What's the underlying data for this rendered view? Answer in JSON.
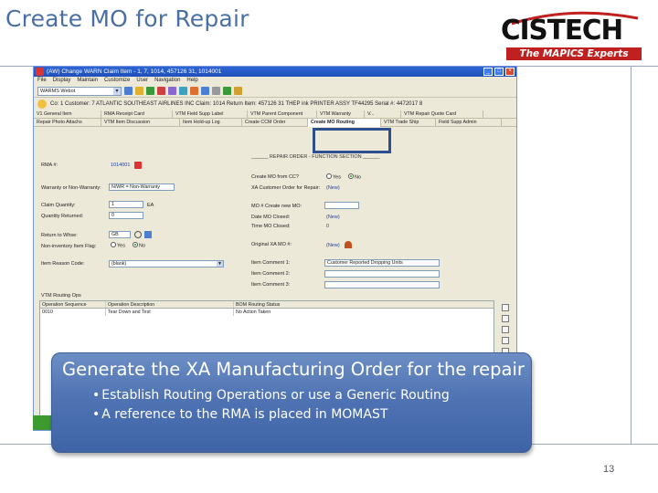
{
  "slide": {
    "title": "Create MO for Repair",
    "page_number": "13"
  },
  "logo": {
    "brand": "CISTECH",
    "tagline": "The MAPICS Experts",
    "color": "#c0201f"
  },
  "window": {
    "title": "(AW) Change WARN Claim Item - 1, 7, 1014, 457126 31, 1014001",
    "menu": [
      "File",
      "Display",
      "Maintain",
      "Customize",
      "User",
      "Navigation",
      "Help"
    ],
    "view_select": "WARMS Webot",
    "header_line": "Co: 1  Customer: 7 ATLANTIC SOUTHEAST AIRLINES INC  Claim: 1014  Return Item: 457126 31 THEP ink  PRINTER ASSY TF44295 Serial #: 4472017 8",
    "tabs_row1": [
      "V1 General Item",
      "RMA Receipt Card",
      "VTM Field Supp Label",
      "VTM Parent Component",
      "VTM Warranty",
      "V...",
      "VTM Repair Quote Card"
    ],
    "tabs_row2": [
      "Repair Photo Attachs",
      "VTM Item Discussion",
      "Item Hold-up Log",
      "Create CCM Order",
      "Create MO Routing",
      "VTM Trade Ship",
      "Field Supp Admin"
    ],
    "active_tab": "Create MO Routing",
    "section_header": "______ REPAIR ORDER - FUNCTION SECTION ______",
    "left_fields": {
      "rma_label": "RMA #:",
      "rma_value": "1014001",
      "warranty_label": "Warranty or Non-Warranty:",
      "warranty_value": "N/WR = Non-Warranty",
      "claim_qty_label": "Claim Quantity:",
      "claim_qty_value": "1",
      "claim_qty_unit": "EA",
      "qty_returned_label": "Quantity Returned:",
      "qty_returned_value": "0",
      "return_whse_label": "Return to Whse:",
      "return_whse_value": "GB",
      "non_inventory_label": "Non-inventory Item Flag:",
      "non_inventory_yes": "Yes",
      "non_inventory_no": "No",
      "reason_code_label": "Item Reason Code:",
      "reason_code_value": "(blank)"
    },
    "right_fields": {
      "create_mo_label": "Create MO from CC?",
      "create_mo_yes": "Yes",
      "create_mo_no": "No",
      "xa_customer_label": "XA Customer Order for Repair:",
      "xa_customer_value": "(New)",
      "mo_create_label": "MO # Create new MO:",
      "date_closed_label": "Date MO Closed:",
      "date_closed_value": "(New)",
      "time_closed_label": "Time MO Closed:",
      "time_closed_value": "0",
      "original_mo_label": "Original XA MO #:",
      "original_mo_value": "(New)",
      "comment1_label": "Item Comment 1:",
      "comment1_value": "Customer Reported Dropping Units",
      "comment2_label": "Item Comment 2:",
      "comment2_value": "",
      "comment3_label": "Item Comment 3:",
      "comment3_value": ""
    },
    "grid": {
      "caption": "VTM Routing Ops",
      "columns": [
        "Operation Sequence",
        "Operation Description",
        "BOM Routing Status"
      ],
      "rows": [
        [
          "0010",
          "Tear Down and Test",
          "No Action Taken"
        ]
      ]
    }
  },
  "callout": {
    "title": "Generate the XA Manufacturing Order for the repair",
    "bullets": [
      "Establish Routing Operations or use a Generic Routing",
      "A reference to the RMA is placed in MOMAST"
    ]
  }
}
